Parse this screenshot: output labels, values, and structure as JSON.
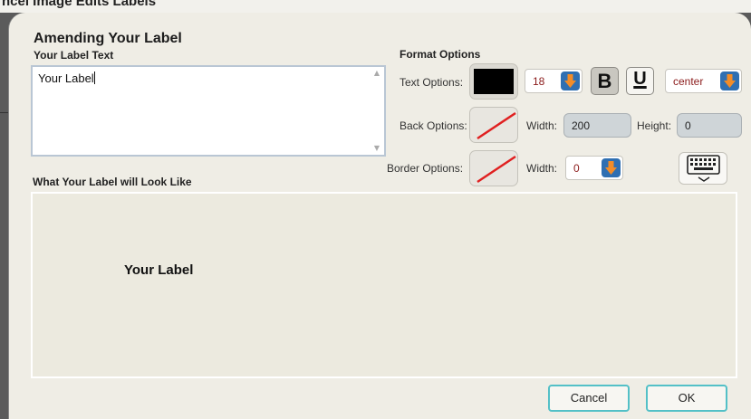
{
  "background": {
    "obscured_text": "ncel Image Edits Labels"
  },
  "dialog": {
    "title": "Amending Your Label",
    "label_text_heading": "Your Label Text",
    "label_text_value": "Your Label",
    "preview_heading": "What Your Label will Look Like",
    "preview_text": "Your Label"
  },
  "format": {
    "heading": "Format Options",
    "text_options_label": "Text Options:",
    "font_size": "18",
    "bold_label": "B",
    "underline_label": "U",
    "alignment": "center",
    "text_color": "#000000",
    "back_options_label": "Back Options:",
    "back_width_label": "Width:",
    "back_width": "200",
    "back_height_label": "Height:",
    "back_height": "0",
    "border_options_label": "Border Options:",
    "border_width_label": "Width:",
    "border_width": "0",
    "keyboard_icon": "keyboard-icon",
    "spinner_icon": "arrow-down-icon",
    "no_color_icon": "no-color-slash-icon"
  },
  "buttons": {
    "cancel": "Cancel",
    "ok": "OK"
  },
  "colors": {
    "accent": "#53c0c7",
    "spinner": "#2f6fb2",
    "spinner_arrow": "#f28c28",
    "value_text": "#8b1a1a"
  }
}
